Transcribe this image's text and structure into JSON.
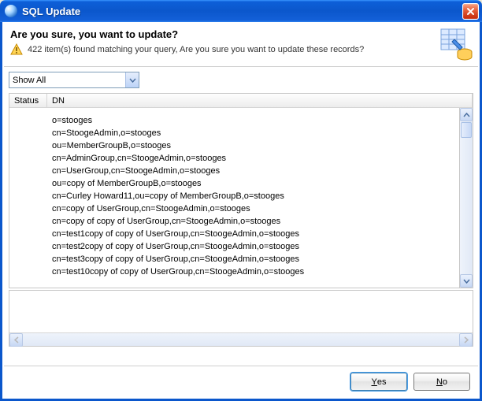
{
  "window": {
    "title": "SQL Update"
  },
  "header": {
    "heading": "Are you sure, you want to update?",
    "message": "422 item(s) found matching your query, Are you sure you want to update these records?"
  },
  "filter": {
    "selected": "Show All"
  },
  "table": {
    "columns": {
      "status": "Status",
      "dn": "DN"
    },
    "rows": [
      {
        "status": "",
        "dn": "o=stooges"
      },
      {
        "status": "",
        "dn": "cn=StoogeAdmin,o=stooges"
      },
      {
        "status": "",
        "dn": "ou=MemberGroupB,o=stooges"
      },
      {
        "status": "",
        "dn": "cn=AdminGroup,cn=StoogeAdmin,o=stooges"
      },
      {
        "status": "",
        "dn": "cn=UserGroup,cn=StoogeAdmin,o=stooges"
      },
      {
        "status": "",
        "dn": "ou=copy of MemberGroupB,o=stooges"
      },
      {
        "status": "",
        "dn": "cn=Curley Howard11,ou=copy of MemberGroupB,o=stooges"
      },
      {
        "status": "",
        "dn": "cn=copy of UserGroup,cn=StoogeAdmin,o=stooges"
      },
      {
        "status": "",
        "dn": "cn=copy of copy of UserGroup,cn=StoogeAdmin,o=stooges"
      },
      {
        "status": "",
        "dn": "cn=test1copy of copy of UserGroup,cn=StoogeAdmin,o=stooges"
      },
      {
        "status": "",
        "dn": "cn=test2copy of copy of UserGroup,cn=StoogeAdmin,o=stooges"
      },
      {
        "status": "",
        "dn": "cn=test3copy of copy of UserGroup,cn=StoogeAdmin,o=stooges"
      },
      {
        "status": "",
        "dn": "cn=test10copy of copy of UserGroup,cn=StoogeAdmin,o=stooges"
      }
    ]
  },
  "textarea": {
    "value": ""
  },
  "buttons": {
    "yes_prefix": "",
    "yes_underline": "Y",
    "yes_rest": "es",
    "no_prefix": "",
    "no_underline": "N",
    "no_rest": "o"
  }
}
